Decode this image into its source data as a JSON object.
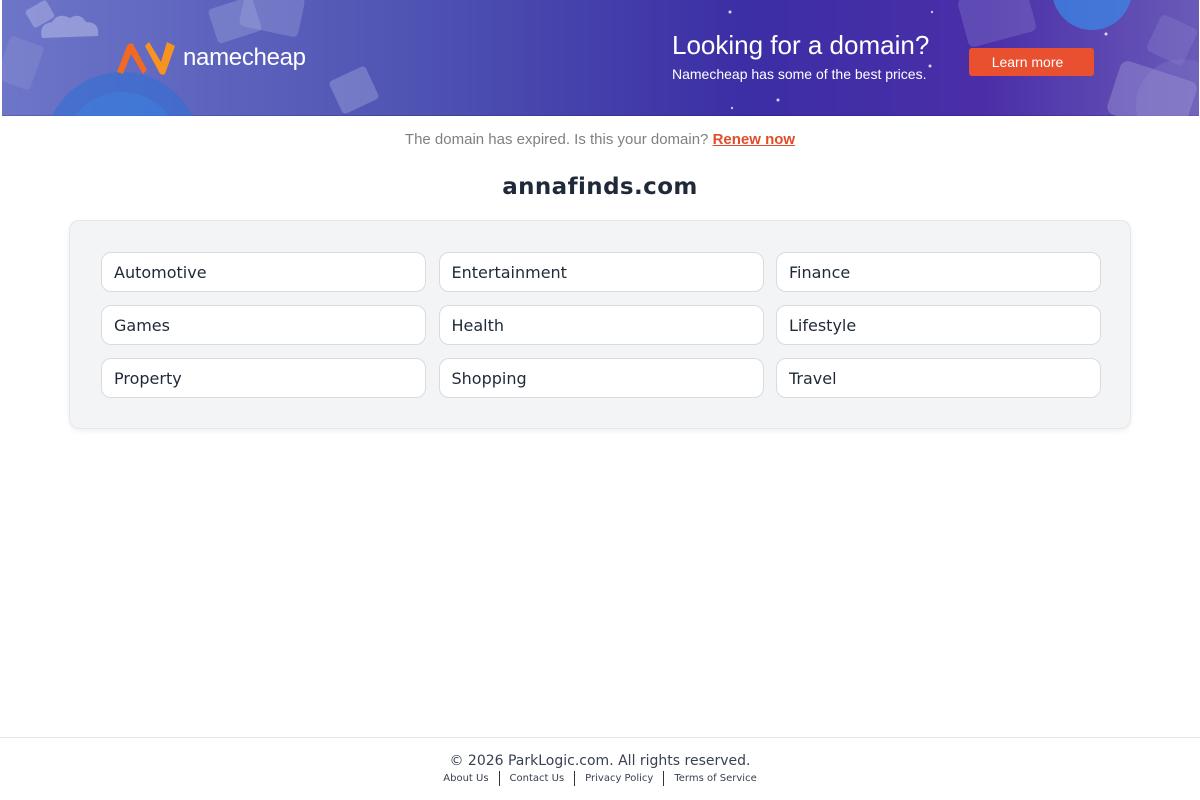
{
  "banner": {
    "logo_text": "namecheap",
    "promo_title": "Looking for a domain?",
    "promo_subtitle": "Namecheap has some of the best prices.",
    "learn_more_label": "Learn more",
    "colors": {
      "gradient_start": "#6d76c9",
      "gradient_mid": "#3c2ea5",
      "button": "#e8502f",
      "logo_orange": "#f26a21"
    }
  },
  "notice": {
    "text": "The domain has expired. Is this your domain?",
    "renew_label": "Renew now",
    "link_color": "#e04e2a"
  },
  "domain": {
    "name": "annafinds.com"
  },
  "categories": [
    "Automotive",
    "Entertainment",
    "Finance",
    "Games",
    "Health",
    "Lifestyle",
    "Property",
    "Shopping",
    "Travel"
  ],
  "footer": {
    "copyright": "© 2026 ParkLogic.com. All rights reserved.",
    "links": [
      "About Us",
      "Contact Us",
      "Privacy Policy",
      "Terms of Service"
    ]
  }
}
